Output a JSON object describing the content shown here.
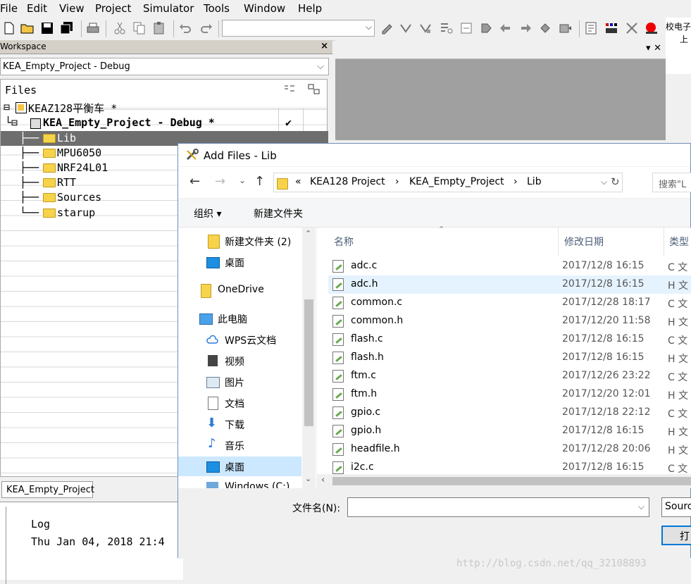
{
  "menu": [
    "File",
    "Edit",
    "View",
    "Project",
    "Simulator",
    "Tools",
    "Window",
    "Help"
  ],
  "right_pane": {
    "line1": "校电子",
    "line2": "上"
  },
  "workspace": {
    "title": "Workspace",
    "close": "×",
    "config": "KEA_Empty_Project - Debug",
    "files_header": "Files",
    "tree": [
      {
        "prefix": "⊟",
        "label": "KEAZ128平衡车 *"
      },
      {
        "prefix": "└⊟",
        "label": "KEA_Empty_Project - Debug *",
        "check": "✔"
      },
      {
        "prefix": "├──",
        "label": "Lib"
      },
      {
        "prefix": "├──",
        "label": "MPU6050"
      },
      {
        "prefix": "├──",
        "label": "NRF24L01"
      },
      {
        "prefix": "├──",
        "label": "RTT"
      },
      {
        "prefix": "├──",
        "label": "Sources"
      },
      {
        "prefix": "└──",
        "label": "starup"
      }
    ],
    "tab": "KEA_Empty_Project"
  },
  "log": {
    "header": "Log",
    "line": "Thu Jan 04, 2018 21:4"
  },
  "dialog": {
    "title": "Add Files - Lib",
    "breadcrumb": [
      "«",
      "KEA128 Project",
      "›",
      "KEA_Empty_Project",
      "›",
      "Lib"
    ],
    "search_placeholder": "搜索\"L",
    "organize": "组织 ▾",
    "new_folder": "新建文件夹",
    "nav_items": [
      {
        "label": "新建文件夹 (2)",
        "icon": "folder-icon"
      },
      {
        "label": "桌面",
        "icon": "desktop-icon"
      },
      {
        "label": "OneDrive",
        "icon": "folder-icon"
      },
      {
        "label": "此电脑",
        "icon": "computer-icon"
      },
      {
        "label": "WPS云文档",
        "icon": "cloud-icon"
      },
      {
        "label": "视频",
        "icon": "video-icon"
      },
      {
        "label": "图片",
        "icon": "picture-icon"
      },
      {
        "label": "文档",
        "icon": "document-icon"
      },
      {
        "label": "下载",
        "icon": "download-icon"
      },
      {
        "label": "音乐",
        "icon": "music-icon"
      },
      {
        "label": "桌面",
        "icon": "desktop-icon"
      },
      {
        "label": "Windows (C:)",
        "icon": "drive-icon"
      }
    ],
    "columns": {
      "name": "名称",
      "date": "修改日期",
      "type": "类型"
    },
    "files": [
      {
        "name": "adc.c",
        "date": "2017/12/8 16:15",
        "type": "C 文"
      },
      {
        "name": "adc.h",
        "date": "2017/12/8 16:15",
        "type": "H 文"
      },
      {
        "name": "common.c",
        "date": "2017/12/28 18:17",
        "type": "C 文"
      },
      {
        "name": "common.h",
        "date": "2017/12/20 11:58",
        "type": "H 文"
      },
      {
        "name": "flash.c",
        "date": "2017/12/8 16:15",
        "type": "C 文"
      },
      {
        "name": "flash.h",
        "date": "2017/12/8 16:15",
        "type": "H 文"
      },
      {
        "name": "ftm.c",
        "date": "2017/12/26 23:22",
        "type": "C 文"
      },
      {
        "name": "ftm.h",
        "date": "2017/12/20 12:01",
        "type": "H 文"
      },
      {
        "name": "gpio.c",
        "date": "2017/12/18 22:12",
        "type": "C 文"
      },
      {
        "name": "gpio.h",
        "date": "2017/12/8 16:15",
        "type": "H 文"
      },
      {
        "name": "headfile.h",
        "date": "2017/12/28 20:06",
        "type": "H 文"
      },
      {
        "name": "i2c.c",
        "date": "2017/12/8 16:15",
        "type": "C 文"
      }
    ],
    "filename_label": "文件名(N):",
    "filename_value": "",
    "filetype": "Sourc",
    "open_button": "打"
  },
  "watermark": "http://blog.csdn.net/qq_32108893",
  "colors": {
    "selection": "#cce8ff",
    "tree_selected": "#6e6e6e",
    "gray_area": "#a0a0a0",
    "open_border": "#0078d7"
  }
}
